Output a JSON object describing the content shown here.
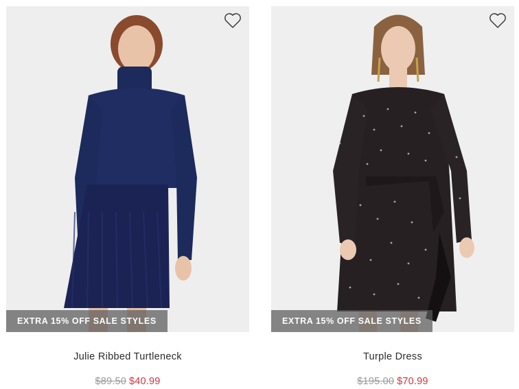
{
  "products": [
    {
      "name": "Julie Ribbed Turtleneck",
      "promo": "EXTRA 15% OFF SALE STYLES",
      "original_price": "$89.50",
      "sale_price": "$40.99",
      "wishlist_icon": "heart-outline-icon"
    },
    {
      "name": "Turple Dress",
      "promo": "EXTRA 15% OFF SALE STYLES",
      "original_price": "$195.00",
      "sale_price": "$70.99",
      "wishlist_icon": "heart-outline-icon"
    }
  ],
  "colors": {
    "sale_price": "#d0343f",
    "original_price": "#9a9a9a",
    "promo_banner": "#5a5a5a"
  }
}
